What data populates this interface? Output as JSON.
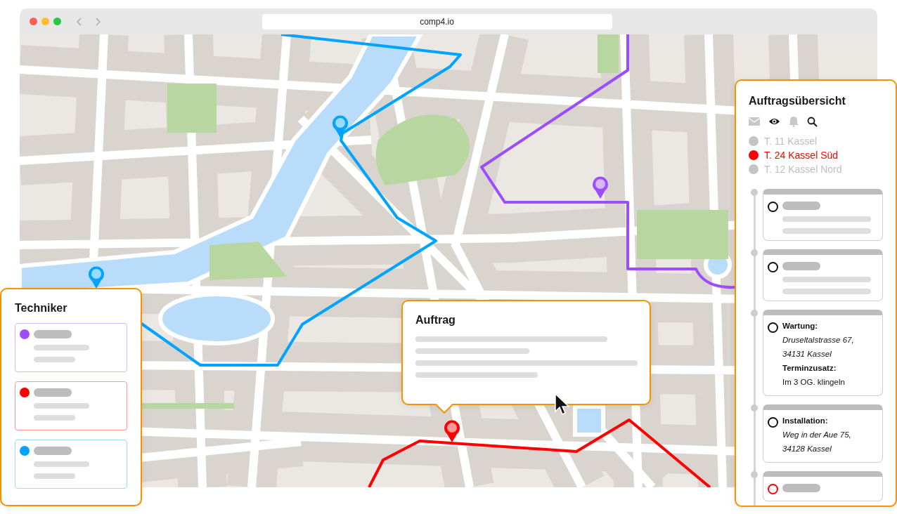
{
  "browser": {
    "url": "comp4.io"
  },
  "technicians_panel": {
    "title": "Techniker",
    "technicians": [
      {
        "color": "#9b4dff"
      },
      {
        "color": "#ff0000"
      },
      {
        "color": "#00a3ff"
      }
    ]
  },
  "order_popup": {
    "title": "Auftrag"
  },
  "overview": {
    "title": "Auftragsübersicht",
    "teams": [
      {
        "label": "T. 11 Kassel",
        "selected": false
      },
      {
        "label": "T. 24 Kassel Süd",
        "selected": true
      },
      {
        "label": "T. 12 Kassel Nord",
        "selected": false
      }
    ],
    "orders": [
      {
        "kind": "placeholder",
        "highlighted": false
      },
      {
        "kind": "placeholder",
        "highlighted": false
      },
      {
        "kind": "detail",
        "highlighted": false,
        "type": "Wartung:",
        "address_lines": [
          "Druseltalstrasse 67,",
          "34131 Kassel"
        ],
        "note_label": "Terminzusatz:",
        "note": "Im 3 OG. klingeln"
      },
      {
        "kind": "detail",
        "highlighted": false,
        "type": "Installation:",
        "address_lines": [
          "Weg in der Aue 75,",
          "34128 Kassel"
        ]
      },
      {
        "kind": "cut",
        "highlighted": true
      }
    ]
  }
}
